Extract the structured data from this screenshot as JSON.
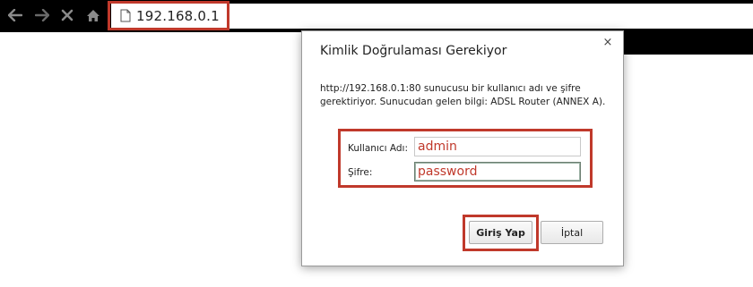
{
  "browser": {
    "url": "192.168.0.1",
    "icons": {
      "back": "back-arrow-icon",
      "forward": "forward-arrow-icon",
      "stop": "close-x-icon",
      "home": "home-icon",
      "page": "page-icon"
    }
  },
  "dialog": {
    "title": "Kimlik Doğrulaması Gerekiyor",
    "close_glyph": "×",
    "message": "http://192.168.0.1:80 sunucusu bir kullanıcı adı ve şifre gerektiriyor. Sunucudan gelen bilgi: ADSL Router (ANNEX A).",
    "username_label": "Kullanıcı Adı:",
    "username_value": "admin",
    "password_label": "Şifre:",
    "password_value": "password",
    "login_button": "Giriş Yap",
    "cancel_button": "İptal"
  },
  "colors": {
    "highlight": "#c0392b",
    "toolbar": "#000000"
  }
}
